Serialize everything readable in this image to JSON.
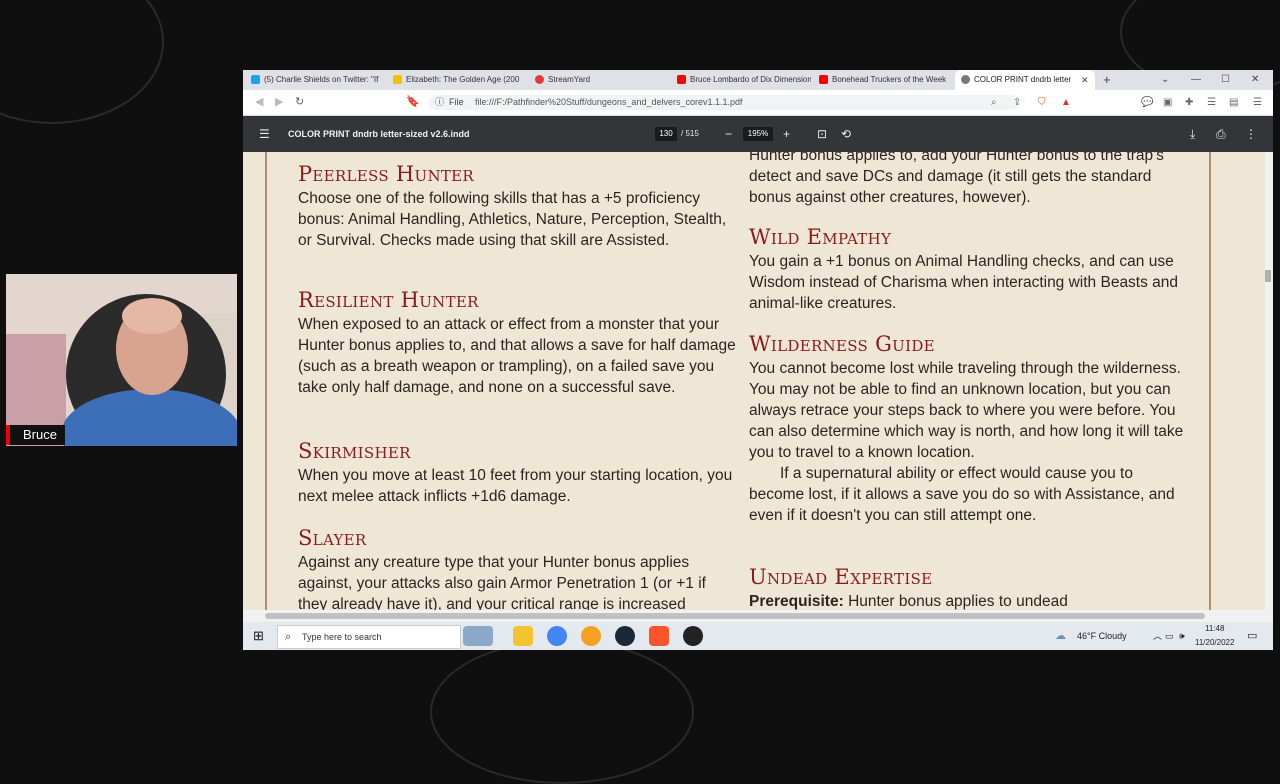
{
  "browser": {
    "tabs": [
      {
        "label": "(5) Charlie Shields on Twitter: \"If",
        "color": "#1da1f2"
      },
      {
        "label": "Elizabeth: The Golden Age (200",
        "color": "#f2c200"
      },
      {
        "label": "StreamYard",
        "color": "#e53935"
      },
      {
        "label": "Bruce Lombardo of Dix Dimension",
        "color": "#ff0000"
      },
      {
        "label": "Bonehead Truckers of the Week",
        "color": "#ff0000"
      },
      {
        "label": "COLOR PRINT dndrb letter",
        "color": "#777777"
      }
    ],
    "address": {
      "scheme": "File",
      "url": "file:///F:/Pathfinder%20Stuff/dungeons_and_delvers_corev1.1.1.pdf"
    }
  },
  "pdf": {
    "title": "COLOR PRINT dndrb letter-sized v2.6.indd",
    "page": "130",
    "total": "/ 515",
    "zoom": "195%"
  },
  "left_column": [
    {
      "heading": "Peerless Hunter",
      "paragraphs": [
        "Choose one of the following skills that has a +5 proficiency bonus: Animal Handling, Athletics, Nature, Perception, Stealth, or Survival. Checks made using that skill are Assisted."
      ]
    },
    {
      "heading": "Resilient Hunter",
      "paragraphs": [
        "When exposed to an attack or effect from a monster that your Hunter bonus applies to, and that allows a save for half damage (such as a breath weapon or trampling), on a failed save you take only half damage, and none on a successful save."
      ]
    },
    {
      "heading": "Skirmisher",
      "paragraphs": [
        "When you move at least 10 feet from your starting location, you next melee attack inflicts +1d6 damage."
      ]
    },
    {
      "heading": "Slayer",
      "paragraphs": [
        "Against any creature type that your Hunter bonus applies against, your attacks also gain Armor Penetration 1 (or +1 if they already have it), and your critical range is increased"
      ]
    }
  ],
  "right_column": {
    "continuation": "Hunter bonus applies to, add your Hunter bonus to the trap's detect and save DCs and damage (it still gets the standard bonus against other creatures, however).",
    "sections": [
      {
        "heading": "Wild Empathy",
        "paragraphs": [
          "You gain a +1 bonus on Animal Handling checks, and can use Wisdom instead of Charisma when interacting with Beasts and animal-like creatures."
        ]
      },
      {
        "heading": "Wilderness Guide",
        "paragraphs": [
          "You cannot become lost while traveling through the wilderness. You may not be able to find an unknown location, but you can always retrace your steps back to where you were before. You can also determine which way is north, and how long it will take you to travel to a known location.",
          "If a supernatural ability or effect would cause you to become lost, if it allows a save you do so with Assistance, and even if it doesn't you can still attempt one."
        ]
      },
      {
        "heading": "Undead Expertise",
        "prereq_label": "Prerequisite:",
        "prereq_text": " Hunter bonus applies to undead"
      }
    ]
  },
  "taskbar": {
    "search_placeholder": "Type here to search",
    "weather": "46°F  Cloudy",
    "time": "11:48",
    "date": "11/20/2022"
  },
  "webcam": {
    "name": "Bruce"
  },
  "colors": {
    "heading": "#8b1a1a",
    "parchment": "#efe7d6",
    "pdf_toolbar": "#323639"
  }
}
